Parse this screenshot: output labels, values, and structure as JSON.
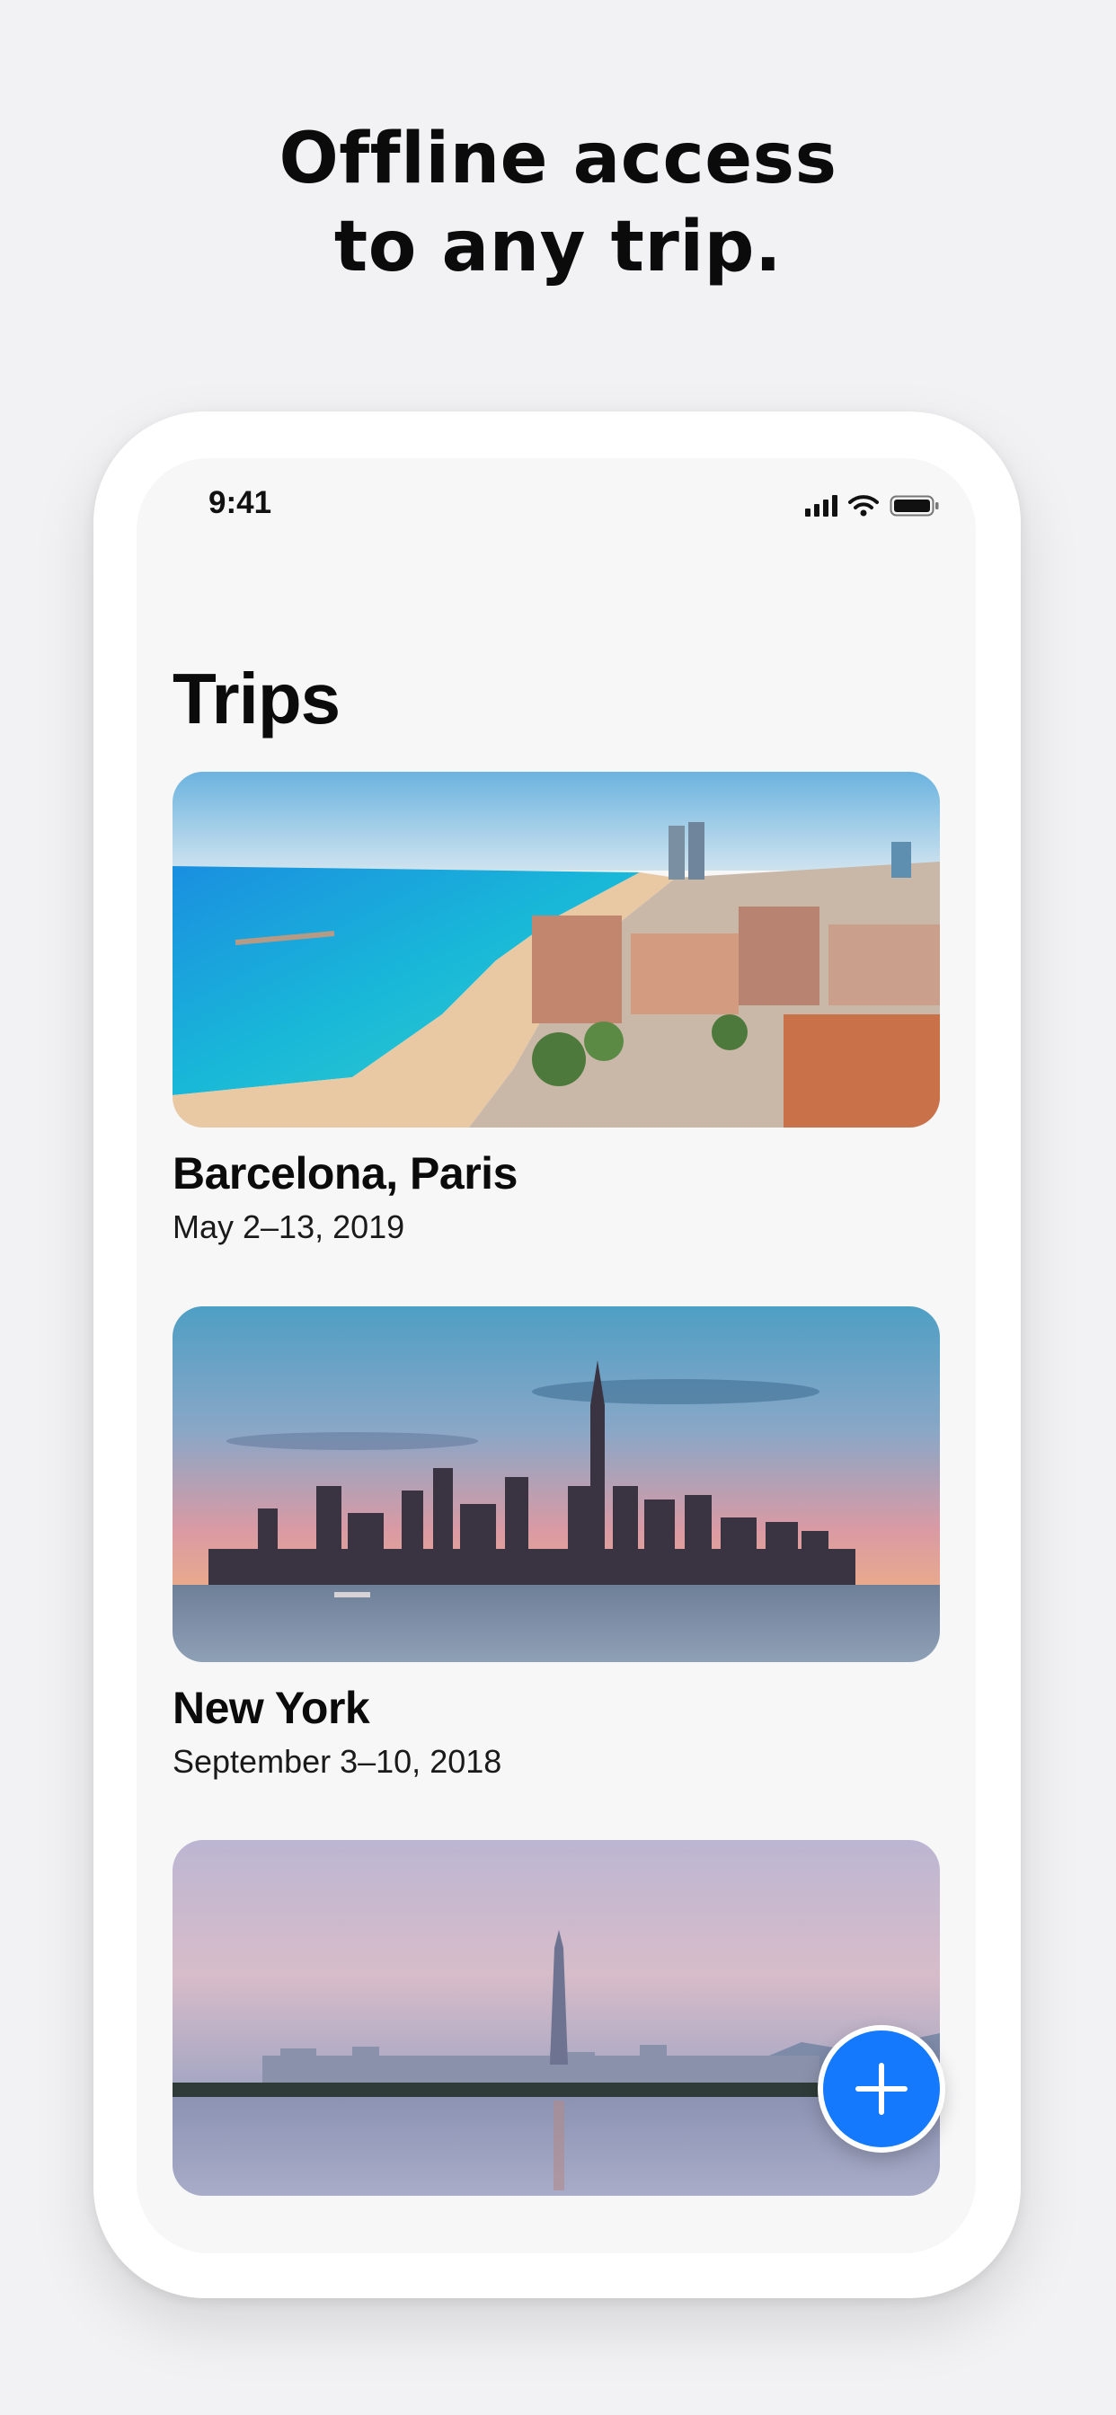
{
  "headline": {
    "line1": "Offline access",
    "line2": "to any trip."
  },
  "statusbar": {
    "time": "9:41",
    "icons": [
      "signal-icon",
      "wifi-icon",
      "battery-icon"
    ]
  },
  "screen_title": "Trips",
  "trips": [
    {
      "name": "Barcelona, Paris",
      "dates": "May 2–13, 2019",
      "image": "barcelona-beach-photo"
    },
    {
      "name": "New York",
      "dates": "September 3–10, 2018",
      "image": "new-york-skyline-photo"
    },
    {
      "image": "seoul-skyline-photo"
    }
  ],
  "fab": {
    "icon": "plus-icon",
    "color": "#1479fc"
  }
}
